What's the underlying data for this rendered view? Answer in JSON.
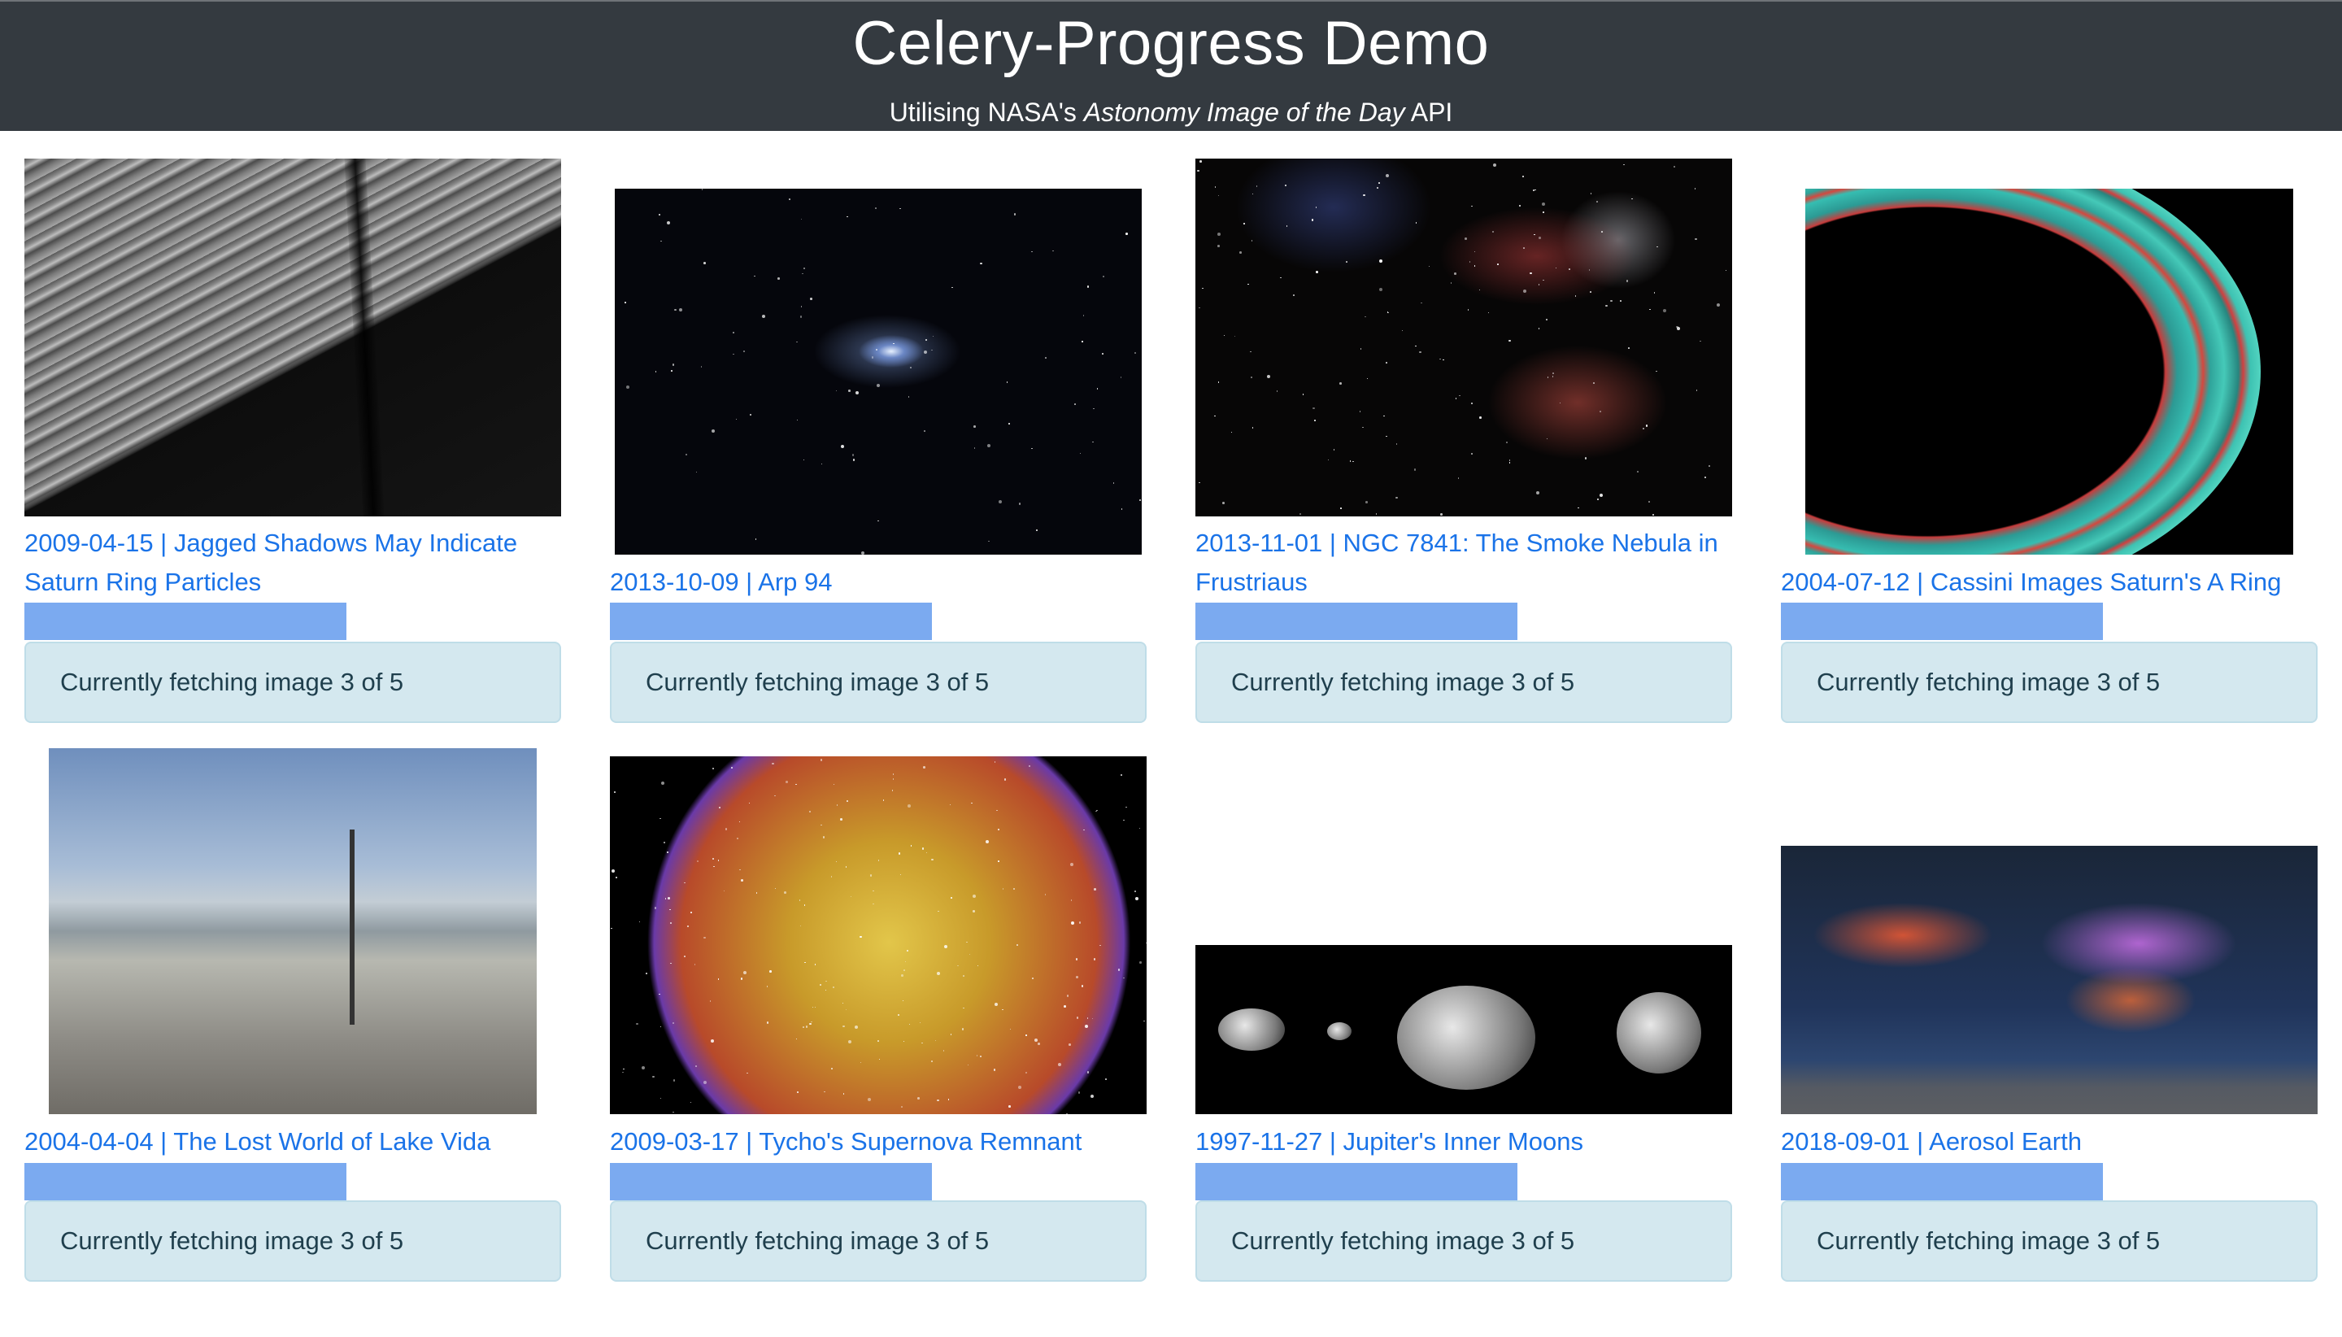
{
  "header": {
    "title": "Celery-Progress Demo",
    "subtitle_prefix": "Utilising NASA's ",
    "subtitle_em": "Astonomy Image of the Day",
    "subtitle_suffix": " API"
  },
  "colors": {
    "header_bg": "#343a40",
    "link": "#1a73e8",
    "progress_fill": "#7baaf0",
    "alert_bg": "#d4e8ef"
  },
  "cards": [
    {
      "caption": "2009-04-15 | Jagged Shadows May Indicate Saturn Ring Particles",
      "progress_fraction": 0.6,
      "status": "Currently fetching image 3 of 5"
    },
    {
      "caption": "2013-10-09 | Arp 94",
      "progress_fraction": 0.6,
      "status": "Currently fetching image 3 of 5"
    },
    {
      "caption": "2013-11-01 | NGC 7841: The Smoke Nebula in Frustriaus",
      "progress_fraction": 0.6,
      "status": "Currently fetching image 3 of 5"
    },
    {
      "caption": "2004-07-12 | Cassini Images Saturn's A Ring",
      "progress_fraction": 0.6,
      "status": "Currently fetching image 3 of 5"
    },
    {
      "caption": "2004-04-04 | The Lost World of Lake Vida",
      "progress_fraction": 0.6,
      "status": "Currently fetching image 3 of 5"
    },
    {
      "caption": "2009-03-17 | Tycho's Supernova Remnant",
      "progress_fraction": 0.6,
      "status": "Currently fetching image 3 of 5"
    },
    {
      "caption": "1997-11-27 | Jupiter's Inner Moons",
      "progress_fraction": 0.6,
      "status": "Currently fetching image 3 of 5"
    },
    {
      "caption": "2018-09-01 | Aerosol Earth",
      "progress_fraction": 0.6,
      "status": "Currently fetching image 3 of 5"
    }
  ]
}
